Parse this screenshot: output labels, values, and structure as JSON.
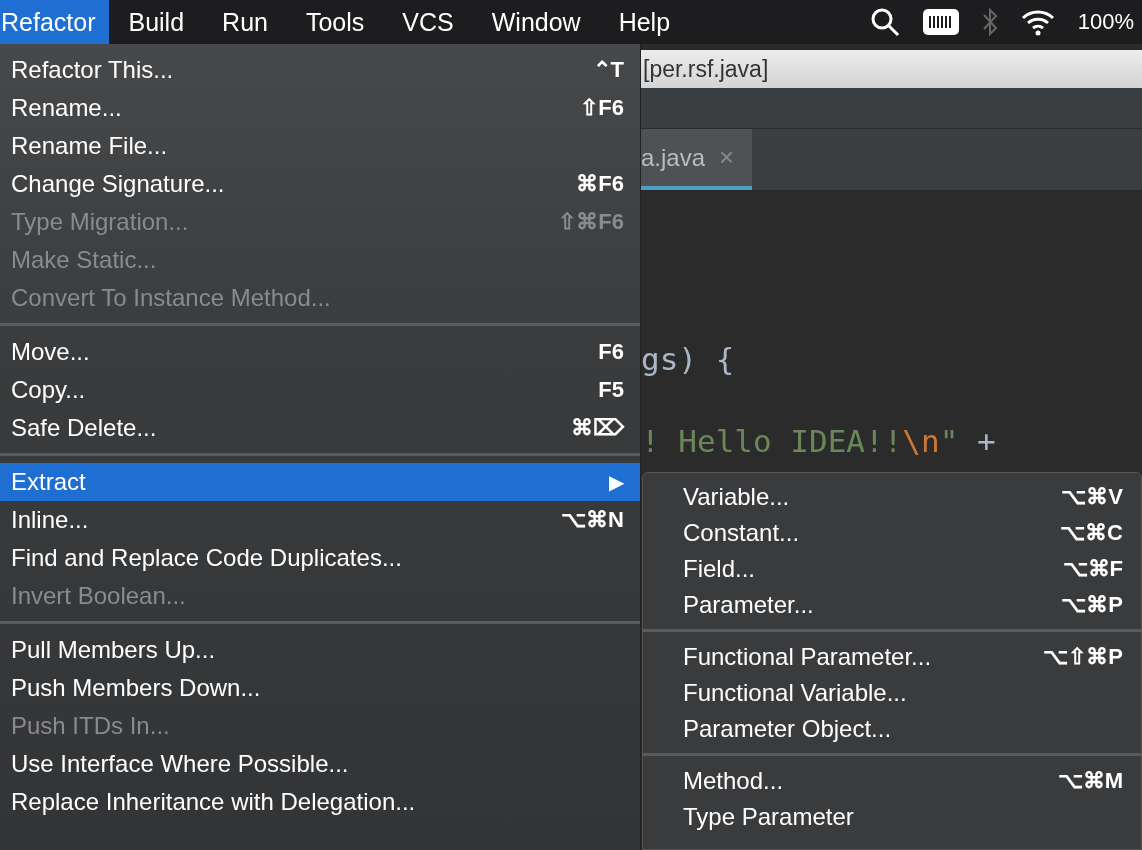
{
  "menubar": {
    "items": [
      {
        "label": "Refactor",
        "selected": true
      },
      {
        "label": "Build",
        "selected": false
      },
      {
        "label": "Run",
        "selected": false
      },
      {
        "label": "Tools",
        "selected": false
      },
      {
        "label": "VCS",
        "selected": false
      },
      {
        "label": "Window",
        "selected": false
      },
      {
        "label": "Help",
        "selected": false
      }
    ],
    "status": {
      "battery_percent": "100%"
    }
  },
  "refactor_menu": {
    "groups": [
      [
        {
          "label": "Refactor This...",
          "shortcut": "⌃T",
          "disabled": false,
          "selected": false
        },
        {
          "label": "Rename...",
          "shortcut": "⇧F6",
          "disabled": false,
          "selected": false
        },
        {
          "label": "Rename File...",
          "disabled": false,
          "selected": false
        },
        {
          "label": "Change Signature...",
          "shortcut": "⌘F6",
          "disabled": false,
          "selected": false
        },
        {
          "label": "Type Migration...",
          "shortcut": "⇧⌘F6",
          "disabled": true,
          "selected": false
        },
        {
          "label": "Make Static...",
          "disabled": true,
          "selected": false
        },
        {
          "label": "Convert To Instance Method...",
          "disabled": true,
          "selected": false
        }
      ],
      [
        {
          "label": "Move...",
          "shortcut": "F6",
          "disabled": false,
          "selected": false
        },
        {
          "label": "Copy...",
          "shortcut": "F5",
          "disabled": false,
          "selected": false
        },
        {
          "label": "Safe Delete...",
          "shortcut": "⌘⌦",
          "disabled": false,
          "selected": false
        }
      ],
      [
        {
          "label": "Extract",
          "submenu_arrow": "▶",
          "disabled": false,
          "selected": true
        },
        {
          "label": "Inline...",
          "shortcut": "⌥⌘N",
          "disabled": false,
          "selected": false
        },
        {
          "label": "Find and Replace Code Duplicates...",
          "disabled": false,
          "selected": false
        },
        {
          "label": "Invert Boolean...",
          "disabled": true,
          "selected": false
        }
      ],
      [
        {
          "label": "Pull Members Up...",
          "disabled": false,
          "selected": false
        },
        {
          "label": "Push Members Down...",
          "disabled": false,
          "selected": false
        },
        {
          "label": "Push ITDs In...",
          "disabled": true,
          "selected": false
        },
        {
          "label": "Use Interface Where Possible...",
          "disabled": false,
          "selected": false
        },
        {
          "label": "Replace Inheritance with Delegation...",
          "disabled": false,
          "selected": false
        }
      ]
    ]
  },
  "extract_submenu": {
    "groups": [
      [
        {
          "label": "Variable...",
          "shortcut": "⌥⌘V"
        },
        {
          "label": "Constant...",
          "shortcut": "⌥⌘C"
        },
        {
          "label": "Field...",
          "shortcut": "⌥⌘F"
        },
        {
          "label": "Parameter...",
          "shortcut": "⌥⌘P"
        }
      ],
      [
        {
          "label": "Functional Parameter...",
          "shortcut": "⌥⇧⌘P"
        },
        {
          "label": "Functional Variable..."
        },
        {
          "label": "Parameter Object..."
        }
      ],
      [
        {
          "label": "Method...",
          "shortcut": "⌥⌘M"
        },
        {
          "label": "Type Parameter"
        }
      ]
    ]
  },
  "ide": {
    "window_title": "[per.rsf.java]",
    "tab": {
      "label": "a.java",
      "close": "×",
      "selected": true
    },
    "code_lines": [
      [
        {
          "kind": "plain",
          "text": "gs) {"
        }
      ],
      [
        {
          "kind": "string",
          "text": "! Hello IDEA!!"
        },
        {
          "kind": "escape",
          "text": "\\n"
        },
        {
          "kind": "string",
          "text": "\""
        },
        {
          "kind": "plain",
          "text": " +"
        }
      ]
    ]
  }
}
